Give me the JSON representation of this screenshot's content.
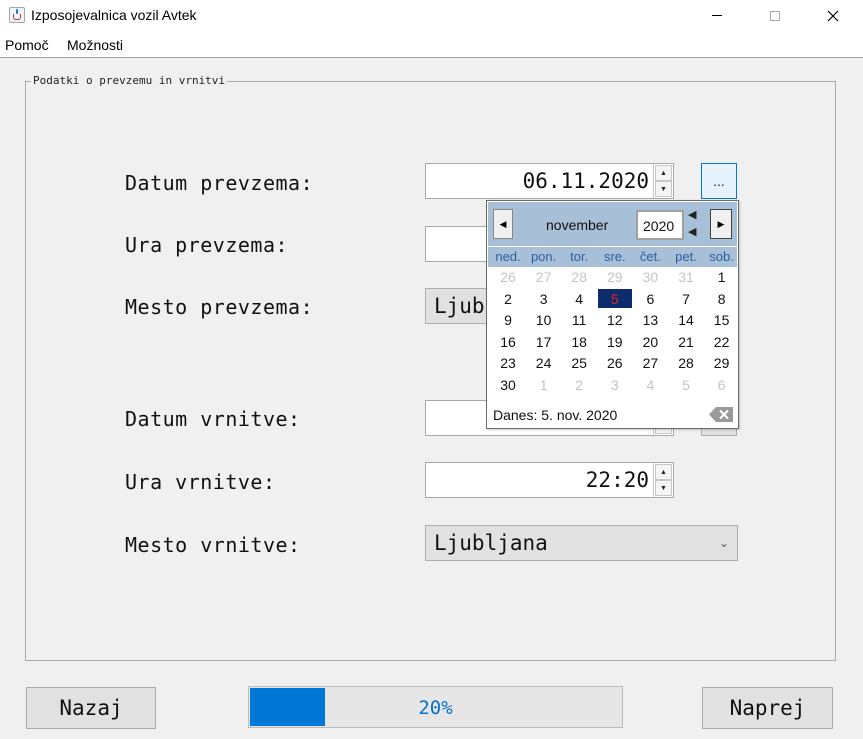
{
  "window": {
    "title": "Izposojevalnica vozil Avtek"
  },
  "menu": {
    "items": [
      "Pomoč",
      "Možnosti"
    ]
  },
  "group_title": "Podatki o prevzemu in vrnitvi",
  "form": {
    "pickup_date_label": "Datum prevzema:",
    "pickup_date_value": "06.11.2020",
    "pickup_time_label": "Ura prevzema:",
    "pickup_place_label": "Mesto prevzema:",
    "pickup_place_value": "Ljub",
    "return_date_label": "Datum vrnitve:",
    "return_time_label": "Ura vrnitve:",
    "return_time_value": "22:20",
    "return_place_label": "Mesto vrnitve:",
    "return_place_value": "Ljubljana",
    "date_button_label": "..."
  },
  "calendar": {
    "month": "november",
    "year": "2020",
    "weekdays": [
      "ned.",
      "pon.",
      "tor.",
      "sre.",
      "čet.",
      "pet.",
      "sob."
    ],
    "weeks": [
      [
        {
          "d": "26",
          "o": true
        },
        {
          "d": "27",
          "o": true
        },
        {
          "d": "28",
          "o": true
        },
        {
          "d": "29",
          "o": true
        },
        {
          "d": "30",
          "o": true
        },
        {
          "d": "31",
          "o": true
        },
        {
          "d": "1"
        }
      ],
      [
        {
          "d": "2"
        },
        {
          "d": "3"
        },
        {
          "d": "4"
        },
        {
          "d": "5",
          "s": true
        },
        {
          "d": "6"
        },
        {
          "d": "7"
        },
        {
          "d": "8"
        }
      ],
      [
        {
          "d": "9"
        },
        {
          "d": "10"
        },
        {
          "d": "11"
        },
        {
          "d": "12"
        },
        {
          "d": "13"
        },
        {
          "d": "14"
        },
        {
          "d": "15"
        }
      ],
      [
        {
          "d": "16"
        },
        {
          "d": "17"
        },
        {
          "d": "18"
        },
        {
          "d": "19"
        },
        {
          "d": "20"
        },
        {
          "d": "21"
        },
        {
          "d": "22"
        }
      ],
      [
        {
          "d": "23"
        },
        {
          "d": "24"
        },
        {
          "d": "25"
        },
        {
          "d": "26"
        },
        {
          "d": "27"
        },
        {
          "d": "28"
        },
        {
          "d": "29"
        }
      ],
      [
        {
          "d": "30"
        },
        {
          "d": "1",
          "o": true
        },
        {
          "d": "2",
          "o": true
        },
        {
          "d": "3",
          "o": true
        },
        {
          "d": "4",
          "o": true
        },
        {
          "d": "5",
          "o": true
        },
        {
          "d": "6",
          "o": true
        }
      ]
    ],
    "today_text": "Danes: 5. nov. 2020"
  },
  "footer": {
    "back_label": "Nazaj",
    "next_label": "Naprej",
    "progress_text": "20%",
    "progress_fraction": 0.2
  },
  "colors": {
    "accent": "#0078d7",
    "calendar_header": "#a8bfd8",
    "selected_day_bg": "#0d2c6b",
    "selected_day_text": "#e32626"
  },
  "icons": {
    "app": "java-cup-icon",
    "clear": "backspace-clear-icon"
  }
}
